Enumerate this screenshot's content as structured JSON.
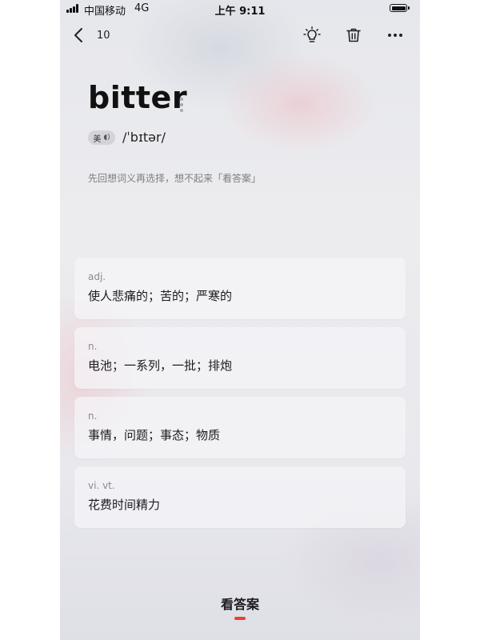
{
  "status_bar": {
    "carrier": "中国移动",
    "network": "4G",
    "time": "上午 9:11"
  },
  "nav": {
    "back_count": "10",
    "icons": [
      "back-chevron-icon",
      "lightbulb-icon",
      "trash-icon",
      "more-icon"
    ]
  },
  "word": {
    "text": "bitter",
    "region": "美",
    "phonetic": "/ˈbɪtər/"
  },
  "hint": "先回想词义再选择，想不起来「看答案」",
  "definitions": [
    {
      "pos": "adj.",
      "meaning": "使人悲痛的；苦的；严寒的"
    },
    {
      "pos": "n.",
      "meaning": "电池；一系列，一批；排炮"
    },
    {
      "pos": "n.",
      "meaning": "事情，问题；事态；物质"
    },
    {
      "pos": "vi. vt.",
      "meaning": "花费时间精力"
    }
  ],
  "footer": {
    "show_answer_label": "看答案"
  },
  "colors": {
    "accent": "#e8403a",
    "text": "#1b1b1f",
    "muted": "#8a8a90"
  }
}
